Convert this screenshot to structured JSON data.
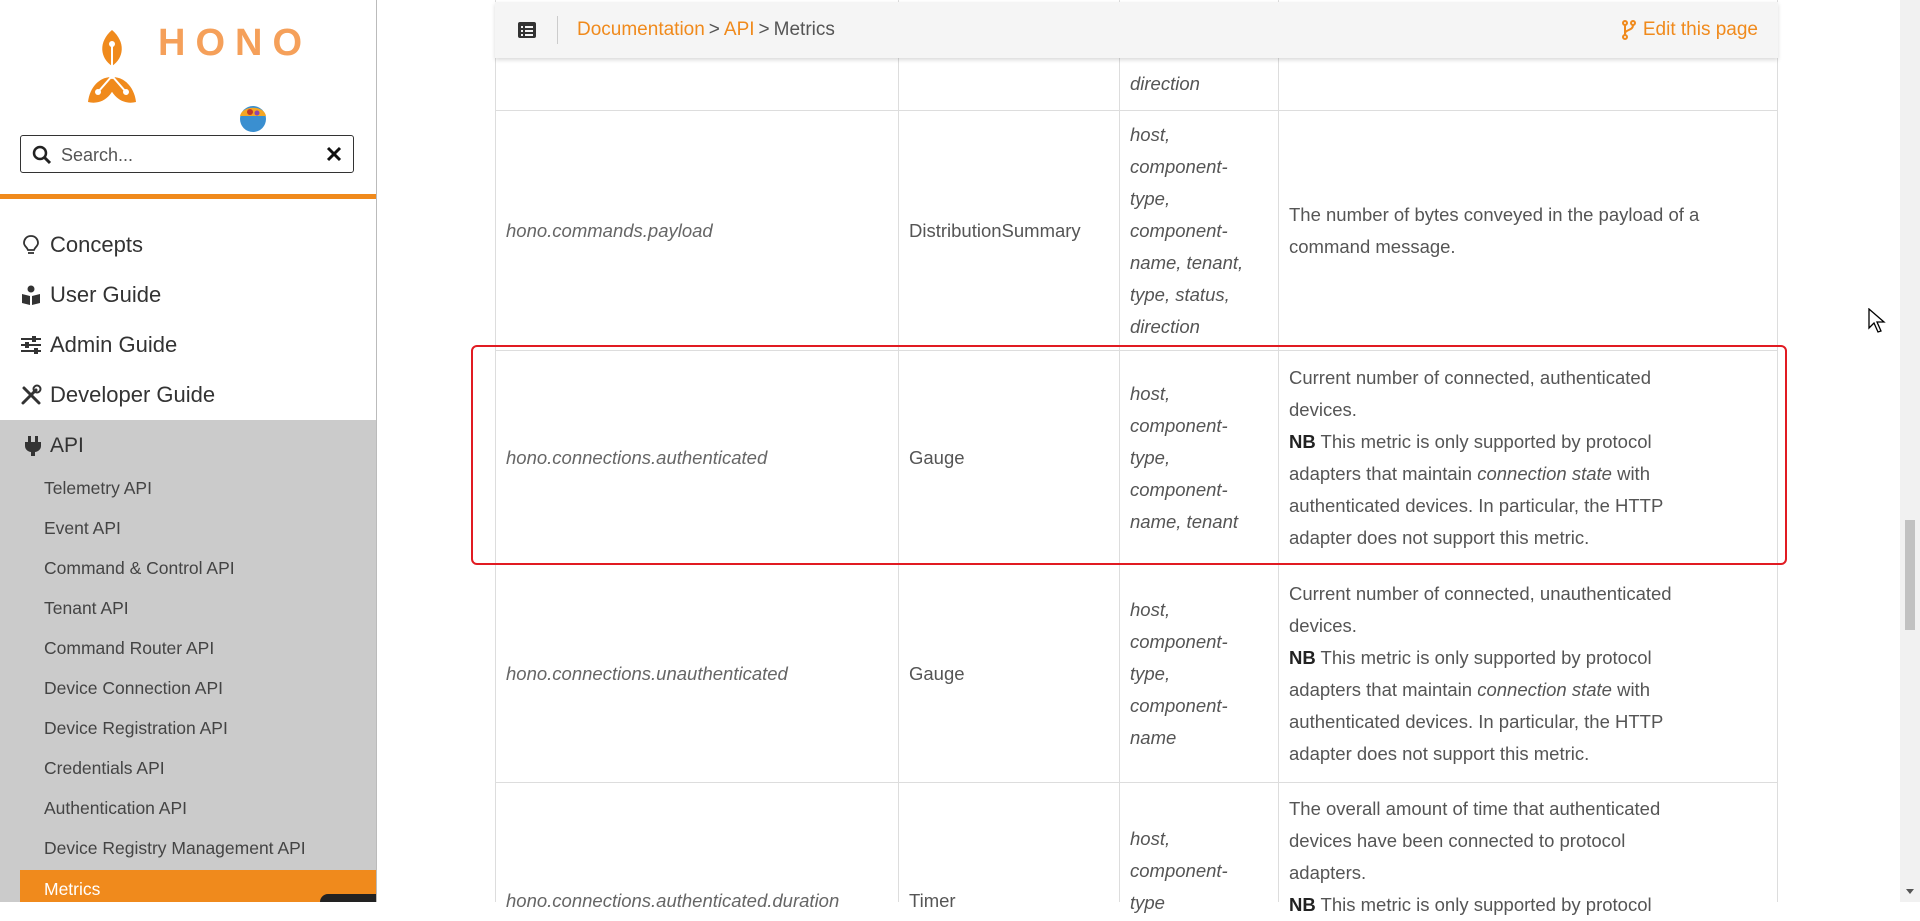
{
  "sidebar": {
    "logo_text": "HONO",
    "search": {
      "placeholder": "Search..."
    },
    "nav": [
      {
        "label": "Concepts",
        "icon": "lightbulb-icon"
      },
      {
        "label": "User Guide",
        "icon": "book-reader-icon"
      },
      {
        "label": "Admin Guide",
        "icon": "sliders-icon"
      },
      {
        "label": "Developer Guide",
        "icon": "tools-icon"
      }
    ],
    "api": {
      "label": "API",
      "icon": "plug-icon",
      "items": [
        "Telemetry API",
        "Event API",
        "Command & Control API",
        "Tenant API",
        "Command Router API",
        "Device Connection API",
        "Device Registration API",
        "Credentials API",
        "Authentication API",
        "Device Registry Management API"
      ],
      "active": "Metrics"
    }
  },
  "topbar": {
    "breadcrumb": [
      "Documentation",
      "API",
      "Metrics"
    ],
    "edit_label": "Edit this page"
  },
  "table": {
    "rows": [
      {
        "tags_tail": "direction"
      },
      {
        "name": "hono.commands.payload",
        "type": "DistributionSummary",
        "tags": [
          "host,",
          "component-",
          "type,",
          "component-",
          "name, tenant,",
          "type, status,",
          "direction"
        ],
        "desc": [
          "The number of bytes conveyed in the payload of a",
          "command message."
        ]
      },
      {
        "name": "hono.connections.authenticated",
        "type": "Gauge",
        "tags": [
          "host,",
          "component-",
          "type,",
          "component-",
          "name, tenant"
        ],
        "desc_lead": [
          "Current number of connected, authenticated",
          "devices."
        ],
        "nb": "NB",
        "nb_text": [
          " This metric is only supported by protocol",
          "adapters that maintain ",
          "connection state",
          " with",
          "authenticated devices. In particular, the HTTP",
          "adapter does not support this metric."
        ]
      },
      {
        "name": "hono.connections.unauthenticated",
        "type": "Gauge",
        "tags": [
          "host,",
          "component-",
          "type,",
          "component-",
          "name"
        ],
        "desc_lead": [
          "Current number of connected, unauthenticated",
          "devices."
        ],
        "nb": "NB",
        "nb_text": [
          " This metric is only supported by protocol",
          "adapters that maintain ",
          "connection state",
          " with",
          "authenticated devices. In particular, the HTTP",
          "adapter does not support this metric."
        ]
      },
      {
        "name": "hono.connections.authenticated.duration",
        "type": "Timer",
        "tags": [
          "host,",
          "component-",
          "type"
        ],
        "desc_lead": [
          "The overall amount of time that authenticated",
          "devices have been connected to protocol",
          "adapters."
        ],
        "nb": "NB",
        "nb_text_partial": " This metric is only supported by protocol"
      }
    ]
  },
  "colors": {
    "accent": "#f08a1c",
    "highlight": "#e11b22",
    "api_bg": "#cbcbcb"
  }
}
